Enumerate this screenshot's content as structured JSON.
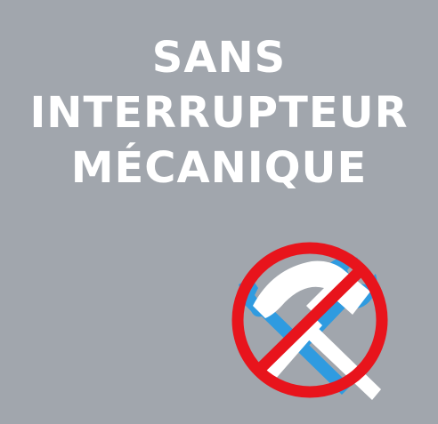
{
  "headline": {
    "line1": "SANS",
    "line2": "INTERRUPTEUR",
    "line3": "MÉCANIQUE"
  },
  "icon": {
    "name": "no-tools-icon",
    "prohibition_color": "#e8141c",
    "tool_color": "#ffffff",
    "tool_accent_color": "#2f9be0"
  },
  "colors": {
    "background": "#a1a6ad",
    "text": "#ffffff"
  }
}
